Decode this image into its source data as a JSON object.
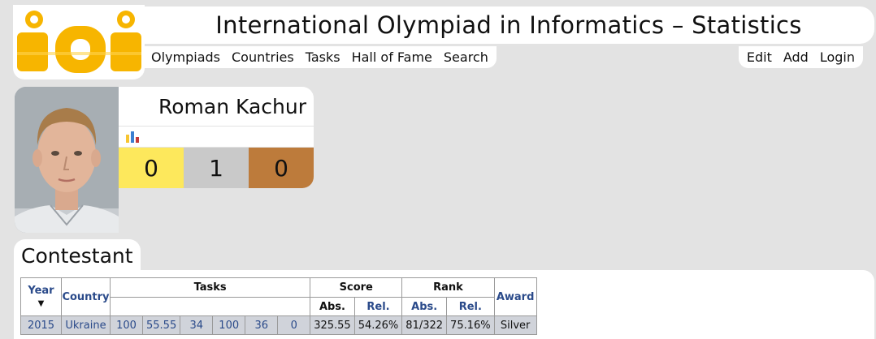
{
  "site": {
    "logo_text": "ioi",
    "title": "International Olympiad in Informatics – Statistics"
  },
  "nav": {
    "left": [
      "Olympiads",
      "Countries",
      "Tasks",
      "Hall of Fame",
      "Search"
    ],
    "right": [
      "Edit",
      "Add",
      "Login"
    ]
  },
  "profile": {
    "name": "Roman Kachur",
    "stats_icon": "bar-chart-icon",
    "medals": {
      "gold": "0",
      "silver": "1",
      "bronze": "0"
    }
  },
  "colors": {
    "gold": "#fde85c",
    "silver": "#c9c9c9",
    "bronze": "#bd7b3b",
    "logo": "#f7b500",
    "link": "#2a4a8a"
  },
  "section": {
    "title": "Contestant"
  },
  "table": {
    "headers": {
      "year": "Year",
      "sort_indicator": "▼",
      "country": "Country",
      "tasks": "Tasks",
      "score": "Score",
      "rank": "Rank",
      "award": "Award",
      "abs": "Abs.",
      "rel": "Rel."
    },
    "rows": [
      {
        "year": "2015",
        "country": "Ukraine",
        "tasks": [
          "100",
          "55.55",
          "34",
          "100",
          "36",
          "0"
        ],
        "score_abs": "325.55",
        "score_rel": "54.26%",
        "rank_abs": "81/322",
        "rank_rel": "75.16%",
        "award": "Silver"
      }
    ]
  }
}
